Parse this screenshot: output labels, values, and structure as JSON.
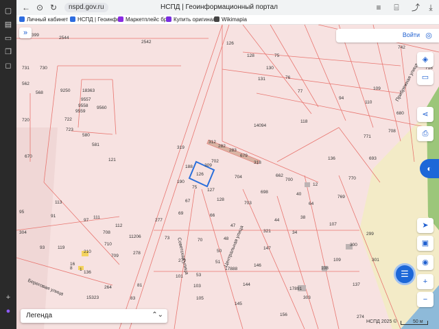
{
  "browser": {
    "url": "nspd.gov.ru",
    "page_title": "НСПД | Геоинформационный портал",
    "bookmarks": [
      {
        "label": "Личный кабинет",
        "color": "#2d6cdf"
      },
      {
        "label": "НСПД | Геоинфо",
        "color": "#2d6cdf"
      },
      {
        "label": "Маркетплейс бр",
        "color": "#8a2be2"
      },
      {
        "label": "Купить оригинал",
        "color": "#7a2ee0"
      },
      {
        "label": "Wikimapia",
        "color": "#444444"
      }
    ]
  },
  "map": {
    "login_label": "Войти",
    "legend_label": "Легенда",
    "streets": [
      "Советская улица",
      "Луговая улица",
      "Береговая улица",
      "Центральная улица",
      "Прибрежная улица"
    ],
    "copyright": "НСПД 2025 ©",
    "scale_label": "50 м",
    "plot_numbers": [
      "2544",
      "2542",
      "399",
      "731",
      "730",
      "9250",
      "18363",
      "562",
      "568",
      "9557",
      "9558",
      "9560",
      "9559",
      "720",
      "722",
      "723",
      "580",
      "581",
      "670",
      "121",
      "319",
      "312",
      "282",
      "283",
      "679",
      "318",
      "702",
      "188",
      "309",
      "126",
      "190",
      "75",
      "127",
      "704",
      "662",
      "700",
      "128",
      "698",
      "67",
      "703",
      "69",
      "66",
      "47",
      "277",
      "70",
      "73",
      "48",
      "50",
      "279",
      "51",
      "97",
      "113",
      "111",
      "112",
      "91",
      "304",
      "93",
      "119",
      "210",
      "16",
      "136",
      "708",
      "95",
      "710",
      "11206",
      "278",
      "709",
      "8",
      "1",
      "264",
      "15323",
      "81",
      "83",
      "101",
      "53",
      "103",
      "105",
      "17888",
      "144",
      "145",
      "146",
      "147",
      "321",
      "34",
      "17891",
      "274",
      "303",
      "156",
      "301",
      "300",
      "299",
      "137",
      "126",
      "128",
      "130",
      "131",
      "75",
      "76",
      "77",
      "94",
      "110",
      "109",
      "118",
      "14094",
      "708",
      "693",
      "771",
      "680",
      "742",
      "718",
      "770",
      "136",
      "12",
      "40",
      "64",
      "44",
      "38",
      "769",
      "107",
      "108",
      "109"
    ],
    "accent_color": "#1e5fd0",
    "parcel_color": "#e8756f",
    "selected_color": "#2a6fdb"
  },
  "os": {
    "sidebar_icons": [
      "tab-icon",
      "calendar-icon",
      "tv-icon",
      "bookmark-icon",
      "chat-icon",
      "download-icon",
      "record-icon"
    ]
  }
}
